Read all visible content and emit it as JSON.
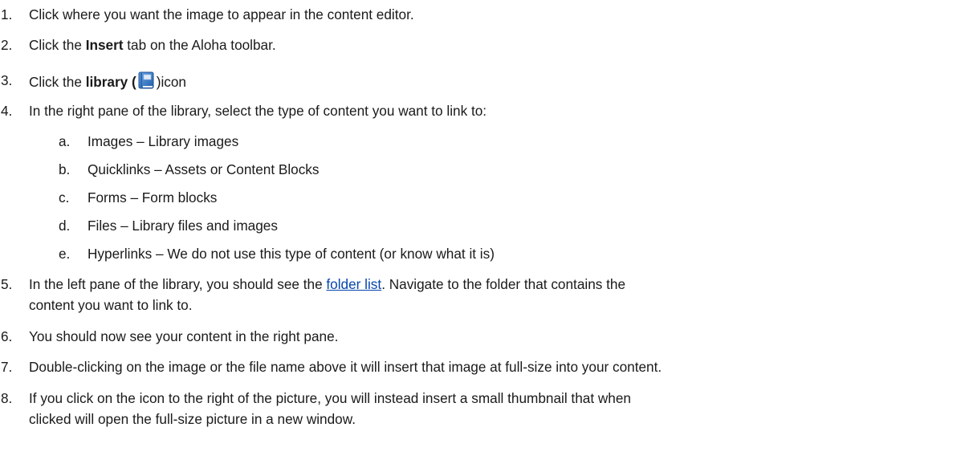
{
  "steps": [
    {
      "num": "1.",
      "text": "Click where you want the image to appear in the content editor."
    },
    {
      "num": "2.",
      "pre": "Click the ",
      "bold": "Insert",
      "post": " tab on the Aloha toolbar."
    },
    {
      "num": "3.",
      "pre": "Click the ",
      "bold": "library (",
      "post": ")icon",
      "icon": "library-book-icon"
    },
    {
      "num": "4.",
      "text": "In the right pane of the library, select the type of content you want to link to:"
    },
    {
      "num": "5.",
      "pre": "In the left pane of the library, you should see the ",
      "link": "folder list",
      "post": ". Navigate to the folder that contains the",
      "cont": "content you want to link to."
    },
    {
      "num": "6.",
      "text": "You should now see your content in the right pane."
    },
    {
      "num": "7.",
      "text": "Double-clicking on the image or the file name above it will insert that image at full-size into your content."
    },
    {
      "num": "8.",
      "text": "If you click on the icon to the right of the picture, you will instead insert a small thumbnail that when",
      "cont": "clicked will open the full-size picture in a new window."
    }
  ],
  "substeps": [
    {
      "num": "a.",
      "text": "Images – Library images"
    },
    {
      "num": "b.",
      "text": "Quicklinks – Assets or Content Blocks"
    },
    {
      "num": "c.",
      "text": "Forms – Form blocks"
    },
    {
      "num": "d.",
      "text": "Files – Library files and images"
    },
    {
      "num": "e.",
      "text": "Hyperlinks – We do not use this type of content (or know what it is)"
    }
  ],
  "colors": {
    "link": "#0645ad",
    "icon_blue": "#3a78c9"
  }
}
